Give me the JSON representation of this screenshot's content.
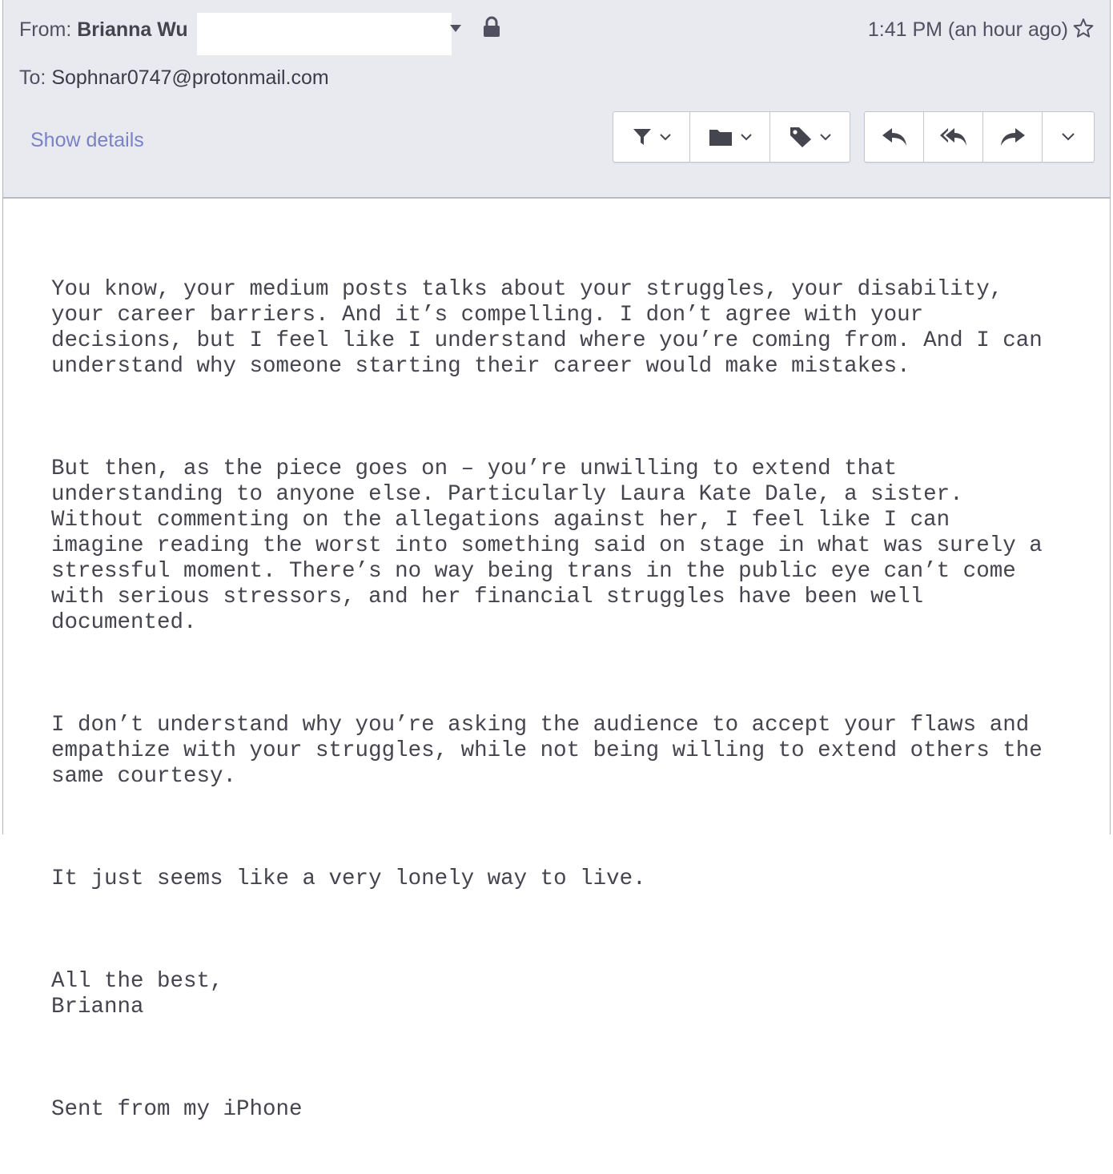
{
  "header": {
    "from_label": "From:",
    "from_name": "Brianna Wu",
    "time": "1:41 PM (an hour ago)",
    "to_label": "To:",
    "to_address": "Sophnar0747@protonmail.com",
    "show_details": "Show details"
  },
  "toolbar": {
    "filter_icon": "filter-icon",
    "folder_icon": "folder-icon",
    "tag_icon": "tag-icon",
    "reply_icon": "reply-icon",
    "reply_all_icon": "reply-all-icon",
    "forward_icon": "forward-icon",
    "more_icon": "chevron-down-icon"
  },
  "body": {
    "paragraphs": [
      "You know, your medium posts talks about your struggles, your disability,\nyour career barriers. And it’s compelling. I don’t agree with your\ndecisions, but I feel like I understand where you’re coming from. And I can\nunderstand why someone starting their career would make mistakes.",
      "But then, as the piece goes on – you’re unwilling to extend that\nunderstanding to anyone else. Particularly Laura Kate Dale, a sister.\nWithout commenting on the allegations against her, I feel like I can\nimagine reading the worst into something said on stage in what was surely a\nstressful moment. There’s no way being trans in the public eye can’t come\nwith serious stressors, and her financial struggles have been well\ndocumented.",
      "I don’t understand why you’re asking the audience to accept your flaws and\nempathize with your struggles, while not being willing to extend others the\nsame courtesy.",
      "It just seems like a very lonely way to live.",
      "All the best,\nBrianna",
      "Sent from my iPhone"
    ]
  },
  "colors": {
    "header_bg": "#e8eaf0",
    "link": "#7a82c4",
    "text": "#505061"
  }
}
